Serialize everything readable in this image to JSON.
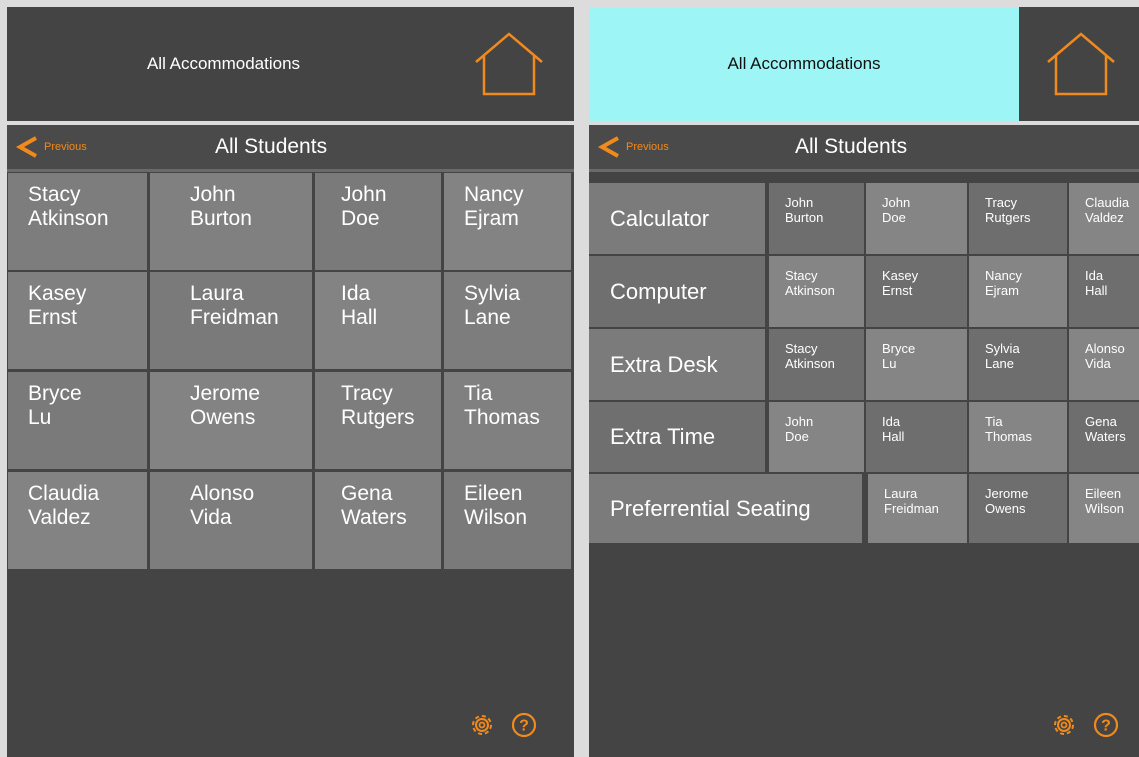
{
  "colors": {
    "accent": "#f08a1c",
    "selected": "#9df5f5",
    "background": "#444444"
  },
  "header": {
    "all_accommodations": "All Accommodations",
    "home_icon": "home-icon"
  },
  "nav": {
    "previous": "Previous",
    "title": "All Students"
  },
  "left_grid": [
    [
      "Stacy",
      "Atkinson"
    ],
    [
      "John",
      "Burton"
    ],
    [
      "John",
      "Doe"
    ],
    [
      "Nancy",
      "Ejram"
    ],
    [
      "Kasey",
      "Ernst"
    ],
    [
      "Laura",
      "Freidman"
    ],
    [
      "Ida",
      "Hall"
    ],
    [
      "Sylvia",
      "Lane"
    ],
    [
      "Bryce",
      "Lu"
    ],
    [
      "Jerome",
      "Owens"
    ],
    [
      "Tracy",
      "Rutgers"
    ],
    [
      "Tia",
      "Thomas"
    ],
    [
      "Claudia",
      "Valdez"
    ],
    [
      "Alonso",
      "Vida"
    ],
    [
      "Gena",
      "Waters"
    ],
    [
      "Eileen",
      "Wilson"
    ]
  ],
  "accommodations": [
    {
      "name": "Calculator",
      "students": [
        [
          "John",
          "Burton"
        ],
        [
          "John",
          "Doe"
        ],
        [
          "Tracy",
          "Rutgers"
        ],
        [
          "Claudia",
          "Valdez"
        ]
      ]
    },
    {
      "name": "Computer",
      "students": [
        [
          "Stacy",
          "Atkinson"
        ],
        [
          "Kasey",
          "Ernst"
        ],
        [
          "Nancy",
          "Ejram"
        ],
        [
          "Ida",
          "Hall"
        ]
      ]
    },
    {
      "name": "Extra Desk",
      "students": [
        [
          "Stacy",
          "Atkinson"
        ],
        [
          "Bryce",
          "Lu"
        ],
        [
          "Sylvia",
          "Lane"
        ],
        [
          "Alonso",
          "Vida"
        ]
      ]
    },
    {
      "name": "Extra Time",
      "students": [
        [
          "John",
          "Doe"
        ],
        [
          "Ida",
          "Hall"
        ],
        [
          "Tia",
          "Thomas"
        ],
        [
          "Gena",
          "Waters"
        ]
      ]
    },
    {
      "name": "Preferrential Seating",
      "students": [
        [
          "Laura",
          "Freidman"
        ],
        [
          "Jerome",
          "Owens"
        ],
        [
          "Eileen",
          "Wilson"
        ]
      ]
    }
  ],
  "footer": {
    "settings_icon": "gear-icon",
    "help_icon": "help-icon"
  }
}
